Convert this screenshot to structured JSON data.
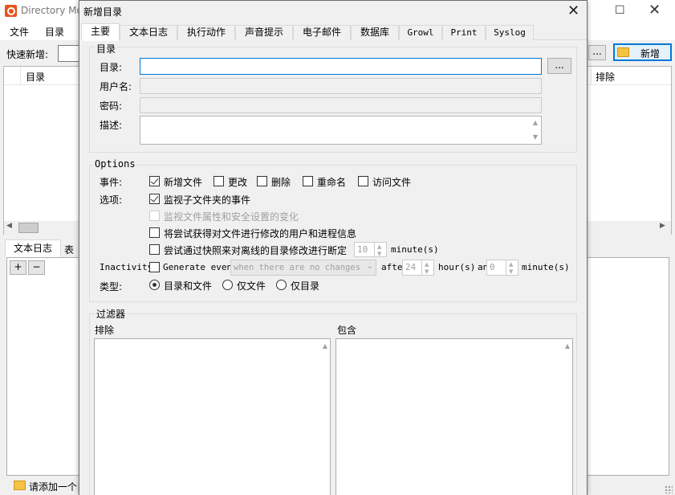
{
  "background_window": {
    "title": "Directory Mo",
    "maximize_glyph": "☐",
    "close_glyph": "✕",
    "menu": [
      "文件",
      "目录"
    ],
    "quick_add_label": "快速新增:",
    "browse_label": "...",
    "add_button_label": "新增",
    "list_columns": [
      "目录",
      "排除"
    ],
    "bottom_tabs": [
      "文本日志",
      "表"
    ],
    "log_plus": "+",
    "log_minus": "−",
    "status_text": "请添加一个目"
  },
  "dialog": {
    "title": "新增目录",
    "close_glyph": "✕",
    "tabs": [
      "主要",
      "文本日志",
      "执行动作",
      "声音提示",
      "电子邮件",
      "数据库",
      "Growl",
      "Print",
      "Syslog"
    ],
    "directory_group": {
      "title": "目录",
      "directory_label": "目录:",
      "directory_value": "",
      "browse_label": "...",
      "username_label": "用户名:",
      "password_label": "密码:",
      "description_label": "描述:"
    },
    "options_group": {
      "title": "Options",
      "events_label": "事件:",
      "events": [
        {
          "label": "新增文件",
          "checked": true
        },
        {
          "label": "更改",
          "checked": false
        },
        {
          "label": "删除",
          "checked": false
        },
        {
          "label": "重命名",
          "checked": false
        },
        {
          "label": "访问文件",
          "checked": false
        }
      ],
      "choices_label": "选项:",
      "watch_subfolders": "监视子文件夹的事件",
      "watch_attributes": "监视文件属性和安全设置的变化",
      "get_user_process": "将尝试获得对文件进行修改的用户和进程信息",
      "snapshot_offline": "尝试通过快照来对离线的目录修改进行断定",
      "snapshot_minutes": "10",
      "minutes_unit": "minute(s)",
      "inactivity_label": "Inactivity",
      "generate_event": "Generate event",
      "generate_select": "when there are no changes",
      "after_label": "after",
      "hours_value": "24",
      "hours_unit": "hour(s)",
      "and_label": "an",
      "minutes_value": "0",
      "minutes_unit2": "minute(s)",
      "type_label": "类型:",
      "types": [
        {
          "label": "目录和文件",
          "checked": true
        },
        {
          "label": "仅文件",
          "checked": false
        },
        {
          "label": "仅目录",
          "checked": false
        }
      ]
    },
    "filter_group": {
      "title": "过滤器",
      "exclude_label": "排除",
      "include_label": "包含"
    }
  }
}
